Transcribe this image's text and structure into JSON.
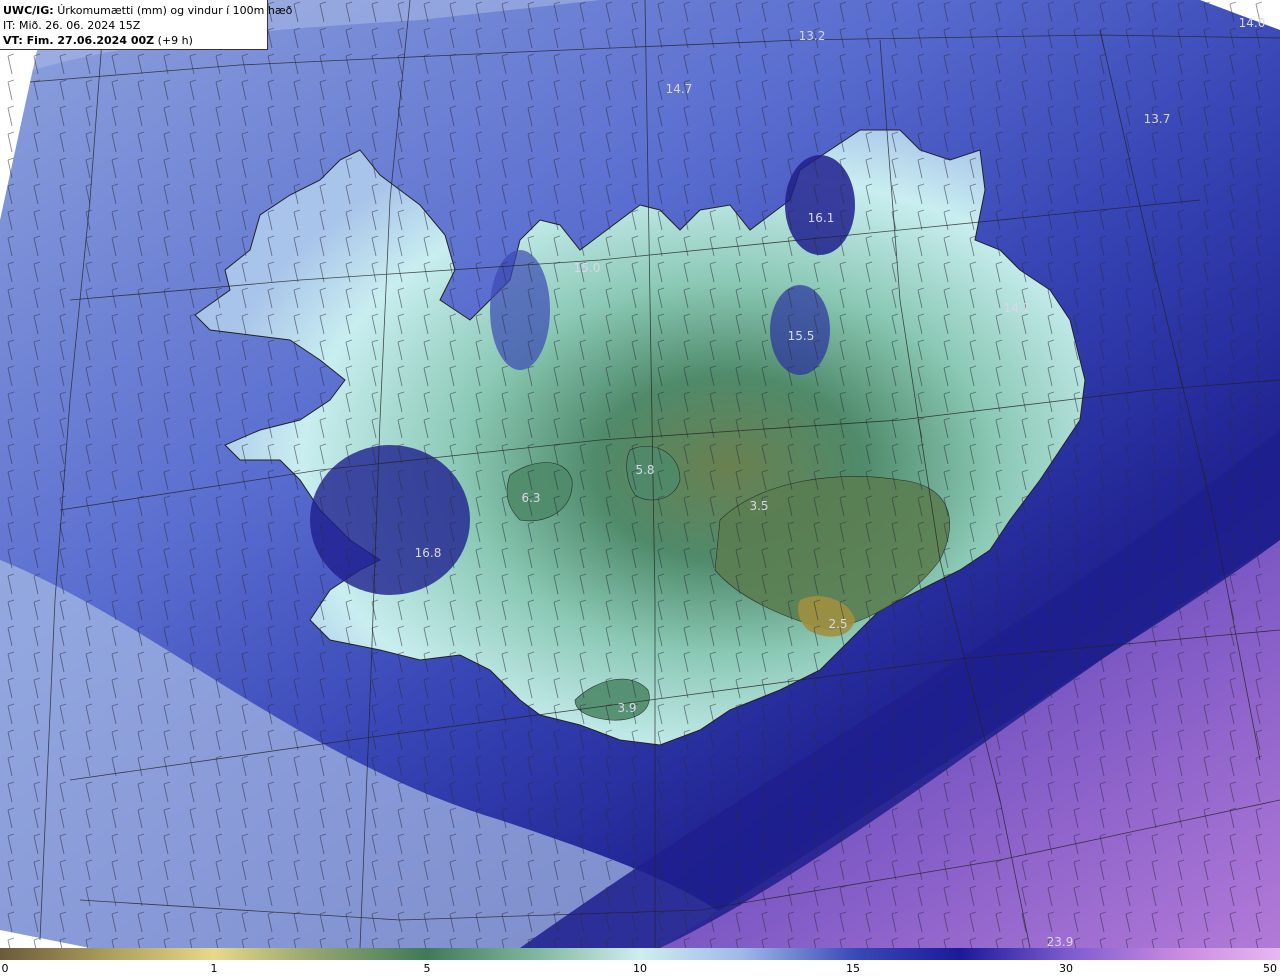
{
  "header": {
    "model": "UWC/IG:",
    "title": "Úrkomumætti (mm) og vindur í 100m hæð",
    "it_line": "IT: Mið. 26. 06. 2024 15Z",
    "vt_label": "VT: Fim. 27.06.2024 00Z",
    "vt_offset": "(+9 h)"
  },
  "map_labels": [
    "13.2",
    "14.0",
    "14.7",
    "13.7",
    "16.1",
    "15.0",
    "14.1",
    "15.5",
    "5.8",
    "6.3",
    "3.5",
    "16.8",
    "2.5",
    "3.9",
    "23.9"
  ],
  "colorbar": {
    "ticks": [
      "0",
      "1",
      "5",
      "10",
      "15",
      "30",
      "50"
    ]
  },
  "colors": {
    "ocean_deep": "#1c1e8c",
    "ocean_mid": "#4b5cc4",
    "ocean_light": "#9db0de",
    "land_light": "#c8eef0",
    "land_green": "#4f8a6a",
    "land_olive": "#7a8a4a",
    "purple": "#8a5cc8"
  }
}
